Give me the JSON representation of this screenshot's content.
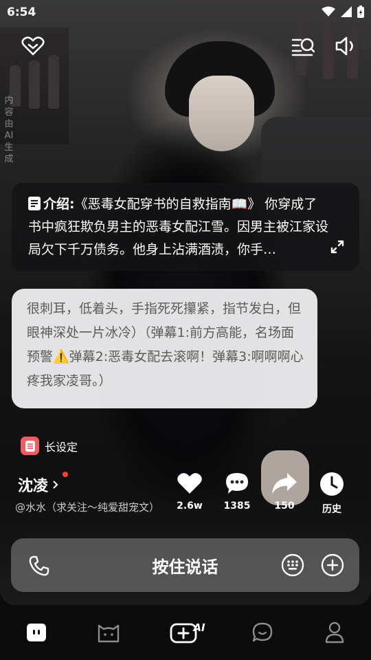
{
  "status": {
    "time": "6:54"
  },
  "vertical_note": "内容由AI生成",
  "intro": {
    "label": "介绍:",
    "text": "《恶毒女配穿书的自救指南📖》 你穿成了书中疯狂欺负男主的恶毒女配江雪。因男主被江家设局欠下千万债务。他身上沾满酒渍，你手…"
  },
  "message": "很刺耳，低着头，手指死死攥紧，指节发白，但眼神深处一片冰冷）（弹幕1:前方高能，名场面预警⚠️弹幕2:恶毒女配去滚啊！弹幕3:啊啊啊心疼我家凌哥。）",
  "long_setting": {
    "label": "长设定"
  },
  "character": {
    "name": "沈凌",
    "author": "@水水（求关注～纯爱甜宠文）"
  },
  "actions": {
    "likes": "2.6w",
    "comments": "1385",
    "shares": "150",
    "history": "历史"
  },
  "input": {
    "hold_to_talk": "按住说话"
  },
  "nav": {
    "ai_label": "AI"
  },
  "colors": {
    "accent_red": "#f25d62",
    "dot_red": "#ff3b30"
  }
}
